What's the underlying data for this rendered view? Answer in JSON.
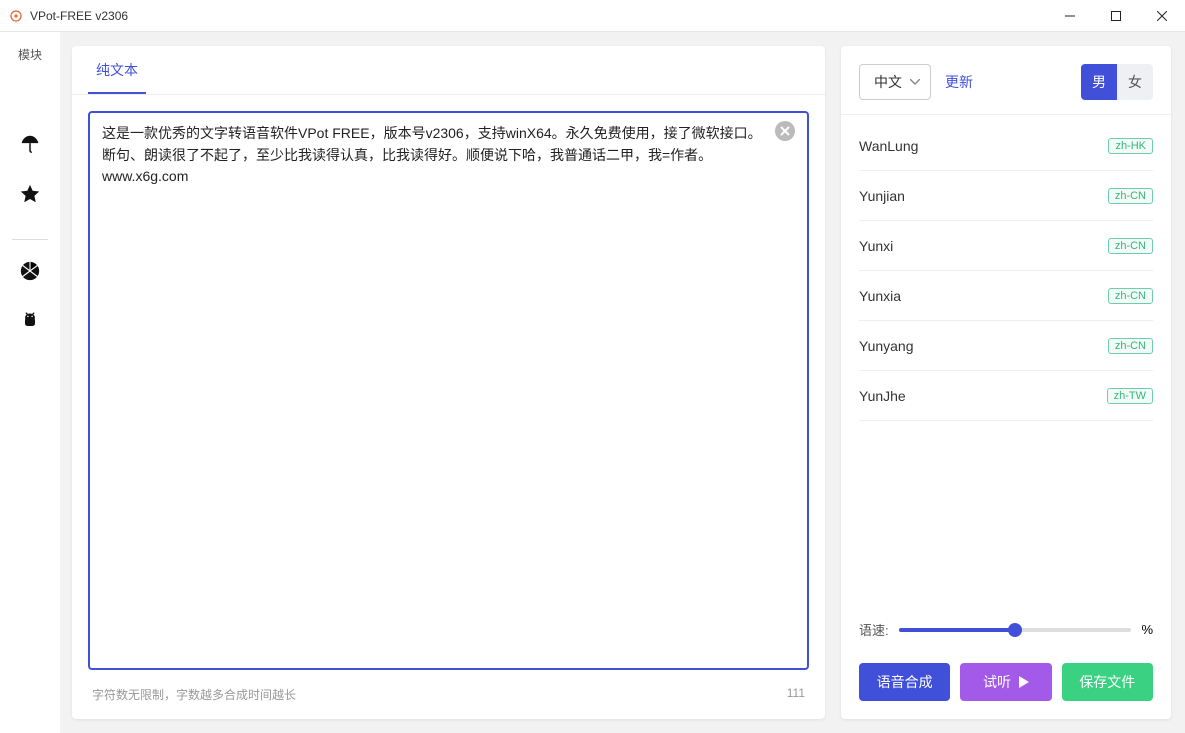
{
  "titlebar": {
    "title": "VPot-FREE v2306"
  },
  "sidebar": {
    "module_label": "模块"
  },
  "left_panel": {
    "tabs": [
      {
        "label": "纯文本",
        "active": true
      }
    ],
    "text_content": "这是一款优秀的文字转语音软件VPot FREE，版本号v2306，支持winX64。永久免费使用，接了微软接口。断句、朗读很了不起了，至少比我读得认真，比我读得好。顺便说下哈，我普通话二甲，我=作者。www.x6g.com",
    "footer_hint": "字符数无限制，字数越多合成时间越长",
    "char_count": "111"
  },
  "right_panel": {
    "language_label": "中文",
    "update_label": "更新",
    "gender": {
      "male": "男",
      "female": "女",
      "active": "male"
    },
    "voices": [
      {
        "name": "WanLung",
        "locale": "zh-HK"
      },
      {
        "name": "Yunjian",
        "locale": "zh-CN"
      },
      {
        "name": "Yunxi",
        "locale": "zh-CN"
      },
      {
        "name": "Yunxia",
        "locale": "zh-CN"
      },
      {
        "name": "Yunyang",
        "locale": "zh-CN"
      },
      {
        "name": "YunJhe",
        "locale": "zh-TW"
      }
    ],
    "speed_label": "语速:",
    "speed_unit": "%",
    "speed_percent": 50,
    "buttons": {
      "synthesize": "语音合成",
      "preview": "试听",
      "save": "保存文件"
    }
  }
}
